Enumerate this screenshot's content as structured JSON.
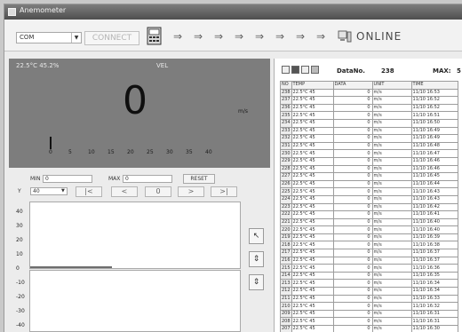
{
  "window": {
    "title": "Anemometer"
  },
  "toolbar": {
    "port_value": "COM",
    "connect_label": "CONNECT",
    "arrow_glyph": "⇒",
    "status_label": "ONLINE"
  },
  "display": {
    "env_reading": "22.5°C 45.2%",
    "mode_label": "VEL",
    "main_value": "0",
    "unit": "m/s",
    "scale_labels": [
      "0",
      "5",
      "10",
      "15",
      "20",
      "25",
      "30",
      "35",
      "40"
    ]
  },
  "controls": {
    "min_label": "MIN",
    "min_value": "0",
    "max_label": "MAX",
    "max_value": "0",
    "reset_label": "RESET",
    "range_label": "Y",
    "range_value": "40",
    "nav_buttons": [
      "|<",
      "<",
      "0",
      ">",
      ">|"
    ]
  },
  "graph": {
    "y_labels": [
      "40",
      "30",
      "20",
      "10",
      "0",
      "-10",
      "-20",
      "-30",
      "-40"
    ],
    "side_buttons": [
      "↖",
      "⇕",
      "⇕"
    ]
  },
  "data_panel": {
    "data_no_label": "DataNo.",
    "data_no_value": "238",
    "max_label": "MAX:",
    "max_value": "5",
    "columns": [
      "NO",
      "TEMP",
      "DATA",
      "UNIT",
      "TIME"
    ],
    "rows": [
      {
        "no": "238",
        "temp": "22.5°C 45",
        "data": "0",
        "unit": "m/s",
        "time": "11/10 16:53"
      },
      {
        "no": "237",
        "temp": "22.5°C 45",
        "data": "0",
        "unit": "m/s",
        "time": "11/10 16:52"
      },
      {
        "no": "236",
        "temp": "22.5°C 45",
        "data": "0",
        "unit": "m/s",
        "time": "11/10 16:52"
      },
      {
        "no": "235",
        "temp": "22.5°C 45",
        "data": "0",
        "unit": "m/s",
        "time": "11/10 16:51"
      },
      {
        "no": "234",
        "temp": "22.5°C 45",
        "data": "0",
        "unit": "m/s",
        "time": "11/10 16:50"
      },
      {
        "no": "233",
        "temp": "22.5°C 45",
        "data": "0",
        "unit": "m/s",
        "time": "11/10 16:49"
      },
      {
        "no": "232",
        "temp": "22.5°C 45",
        "data": "0",
        "unit": "m/s",
        "time": "11/10 16:49"
      },
      {
        "no": "231",
        "temp": "22.5°C 45",
        "data": "0",
        "unit": "m/s",
        "time": "11/10 16:48"
      },
      {
        "no": "230",
        "temp": "22.5°C 45",
        "data": "0",
        "unit": "m/s",
        "time": "11/10 16:47"
      },
      {
        "no": "229",
        "temp": "22.5°C 45",
        "data": "0",
        "unit": "m/s",
        "time": "11/10 16:46"
      },
      {
        "no": "228",
        "temp": "22.5°C 45",
        "data": "0",
        "unit": "m/s",
        "time": "11/10 16:46"
      },
      {
        "no": "227",
        "temp": "22.5°C 45",
        "data": "0",
        "unit": "m/s",
        "time": "11/10 16:45"
      },
      {
        "no": "226",
        "temp": "22.5°C 45",
        "data": "0",
        "unit": "m/s",
        "time": "11/10 16:44"
      },
      {
        "no": "225",
        "temp": "22.5°C 45",
        "data": "0",
        "unit": "m/s",
        "time": "11/10 16:43"
      },
      {
        "no": "224",
        "temp": "22.5°C 45",
        "data": "0",
        "unit": "m/s",
        "time": "11/10 16:43"
      },
      {
        "no": "223",
        "temp": "22.5°C 45",
        "data": "0",
        "unit": "m/s",
        "time": "11/10 16:42"
      },
      {
        "no": "222",
        "temp": "22.5°C 45",
        "data": "0",
        "unit": "m/s",
        "time": "11/10 16:41"
      },
      {
        "no": "221",
        "temp": "22.5°C 45",
        "data": "0",
        "unit": "m/s",
        "time": "11/10 16:40"
      },
      {
        "no": "220",
        "temp": "22.5°C 45",
        "data": "0",
        "unit": "m/s",
        "time": "11/10 16:40"
      },
      {
        "no": "219",
        "temp": "22.5°C 45",
        "data": "0",
        "unit": "m/s",
        "time": "11/10 16:39"
      },
      {
        "no": "218",
        "temp": "22.5°C 45",
        "data": "0",
        "unit": "m/s",
        "time": "11/10 16:38"
      },
      {
        "no": "217",
        "temp": "22.5°C 45",
        "data": "0",
        "unit": "m/s",
        "time": "11/10 16:37"
      },
      {
        "no": "216",
        "temp": "22.5°C 45",
        "data": "0",
        "unit": "m/s",
        "time": "11/10 16:37"
      },
      {
        "no": "215",
        "temp": "22.5°C 45",
        "data": "0",
        "unit": "m/s",
        "time": "11/10 16:36"
      },
      {
        "no": "214",
        "temp": "22.5°C 45",
        "data": "0",
        "unit": "m/s",
        "time": "11/10 16:35"
      },
      {
        "no": "213",
        "temp": "22.5°C 45",
        "data": "0",
        "unit": "m/s",
        "time": "11/10 16:34"
      },
      {
        "no": "212",
        "temp": "22.5°C 45",
        "data": "0",
        "unit": "m/s",
        "time": "11/10 16:34"
      },
      {
        "no": "211",
        "temp": "22.5°C 45",
        "data": "0",
        "unit": "m/s",
        "time": "11/10 16:33"
      },
      {
        "no": "210",
        "temp": "22.5°C 45",
        "data": "0",
        "unit": "m/s",
        "time": "11/10 16:32"
      },
      {
        "no": "209",
        "temp": "22.5°C 45",
        "data": "0",
        "unit": "m/s",
        "time": "11/10 16:31"
      },
      {
        "no": "208",
        "temp": "22.5°C 45",
        "data": "0",
        "unit": "m/s",
        "time": "11/10 16:31"
      },
      {
        "no": "207",
        "temp": "22.5°C 45",
        "data": "0",
        "unit": "m/s",
        "time": "11/10 16:30"
      }
    ]
  },
  "colors": {
    "display_bg": "#7d7d7d",
    "titlebar": "#5e5e5e",
    "trace": "#6e6e6e"
  }
}
